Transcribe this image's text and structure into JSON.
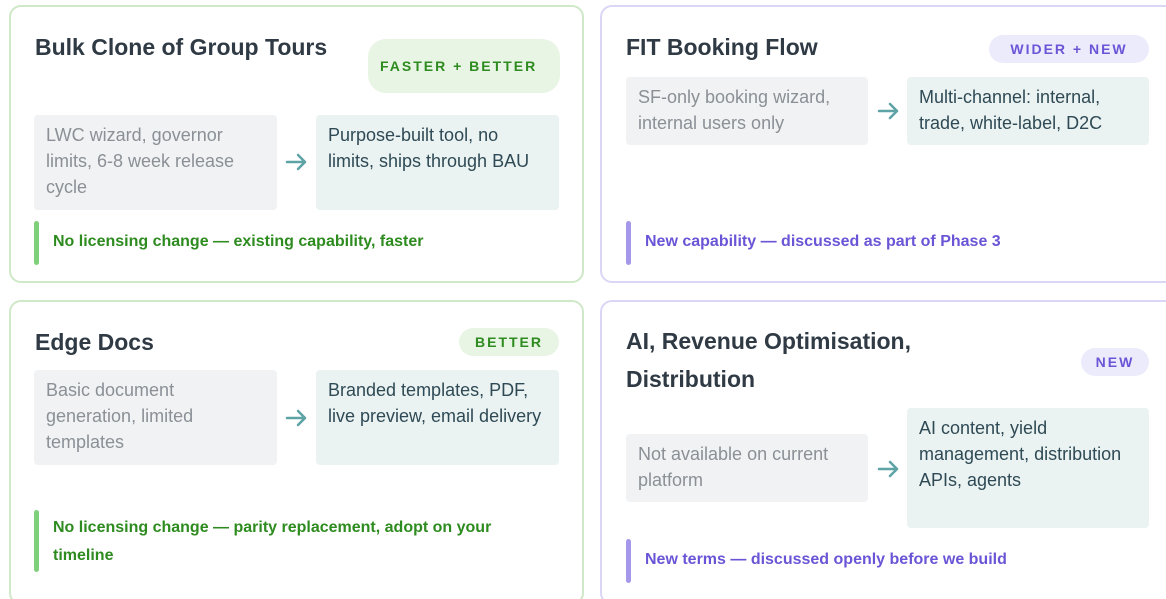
{
  "cards": [
    {
      "title": "Bulk Clone of Group Tours",
      "badge": "FASTER + BETTER",
      "before": "LWC wizard, governor limits, 6-8 week release cycle",
      "after": "Purpose-built tool, no limits, ships through BAU",
      "note": "No licensing change — existing capability, faster"
    },
    {
      "title": "FIT Booking Flow",
      "badge": "WIDER + NEW",
      "before": "SF-only booking wizard, internal users only",
      "after": "Multi-channel: internal, trade, white-label, D2C",
      "note": "New capability — discussed as part of Phase 3"
    },
    {
      "title": "Edge Docs",
      "badge": "BETTER",
      "before": "Basic document generation, limited templates",
      "after": "Branded templates, PDF, live preview, email delivery",
      "note": "No licensing change — parity replacement, adopt on your timeline"
    },
    {
      "title": "AI, Revenue Optimisation, Distribution",
      "badge": "NEW",
      "before": "Not available on current platform",
      "after": "AI content, yield management, distribution APIs, agents",
      "note": "New terms — discussed openly before we build"
    }
  ],
  "colors": {
    "green_accent": "#2e8b1f",
    "purple_accent": "#6b55d6",
    "arrow": "#5ea3a6"
  },
  "icons": {
    "transition": "arrow-right-icon"
  }
}
